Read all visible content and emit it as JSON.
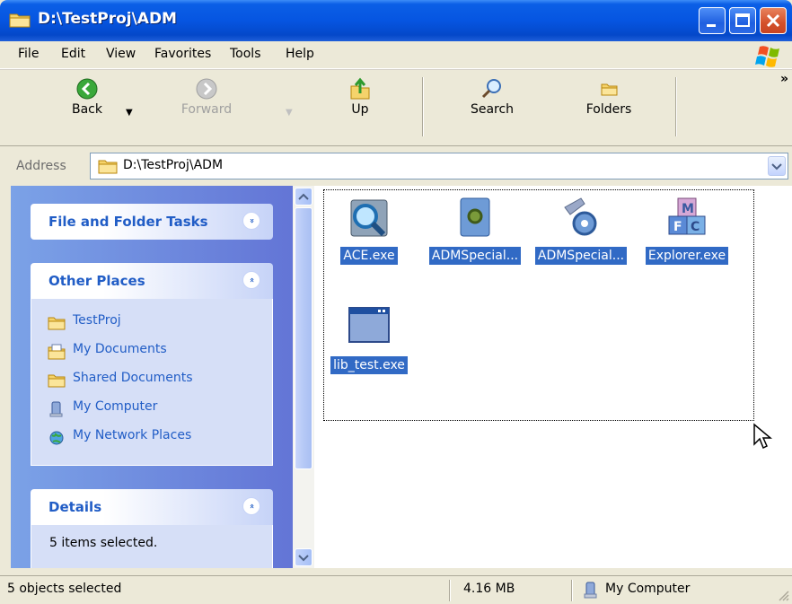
{
  "window": {
    "title": "D:\\TestProj\\ADM"
  },
  "menu": [
    "File",
    "Edit",
    "View",
    "Favorites",
    "Tools",
    "Help"
  ],
  "toolbar": {
    "back": "Back",
    "forward": "Forward",
    "up": "Up",
    "search": "Search",
    "folders": "Folders",
    "more": "»"
  },
  "address": {
    "label": "Address",
    "value": "D:\\TestProj\\ADM"
  },
  "taskpane": {
    "file_tasks": {
      "title": "File and Folder Tasks",
      "expand": "»"
    },
    "other_places": {
      "title": "Other Places",
      "collapse": "«",
      "items": [
        "TestProj",
        "My Documents",
        "Shared Documents",
        "My Computer",
        "My Network Places"
      ]
    },
    "details": {
      "title": "Details",
      "collapse": "«",
      "text": "5 items selected."
    }
  },
  "files": [
    {
      "name": "ACE.exe",
      "icon": "magnifier-app-icon"
    },
    {
      "name": "ADMSpecial...",
      "icon": "gear-document-icon"
    },
    {
      "name": "ADMSpecial...",
      "icon": "gear-tools-icon"
    },
    {
      "name": "Explorer.exe",
      "icon": "mfc-blocks-icon"
    },
    {
      "name": "lib_test.exe",
      "icon": "application-window-icon"
    }
  ],
  "status": {
    "selection": "5 objects selected",
    "size": "4.16 MB",
    "location": "My Computer"
  },
  "colors": {
    "titlebar": "#0655e1",
    "selection": "#316ac5",
    "link": "#215dc6",
    "pane": "#6375d6"
  }
}
